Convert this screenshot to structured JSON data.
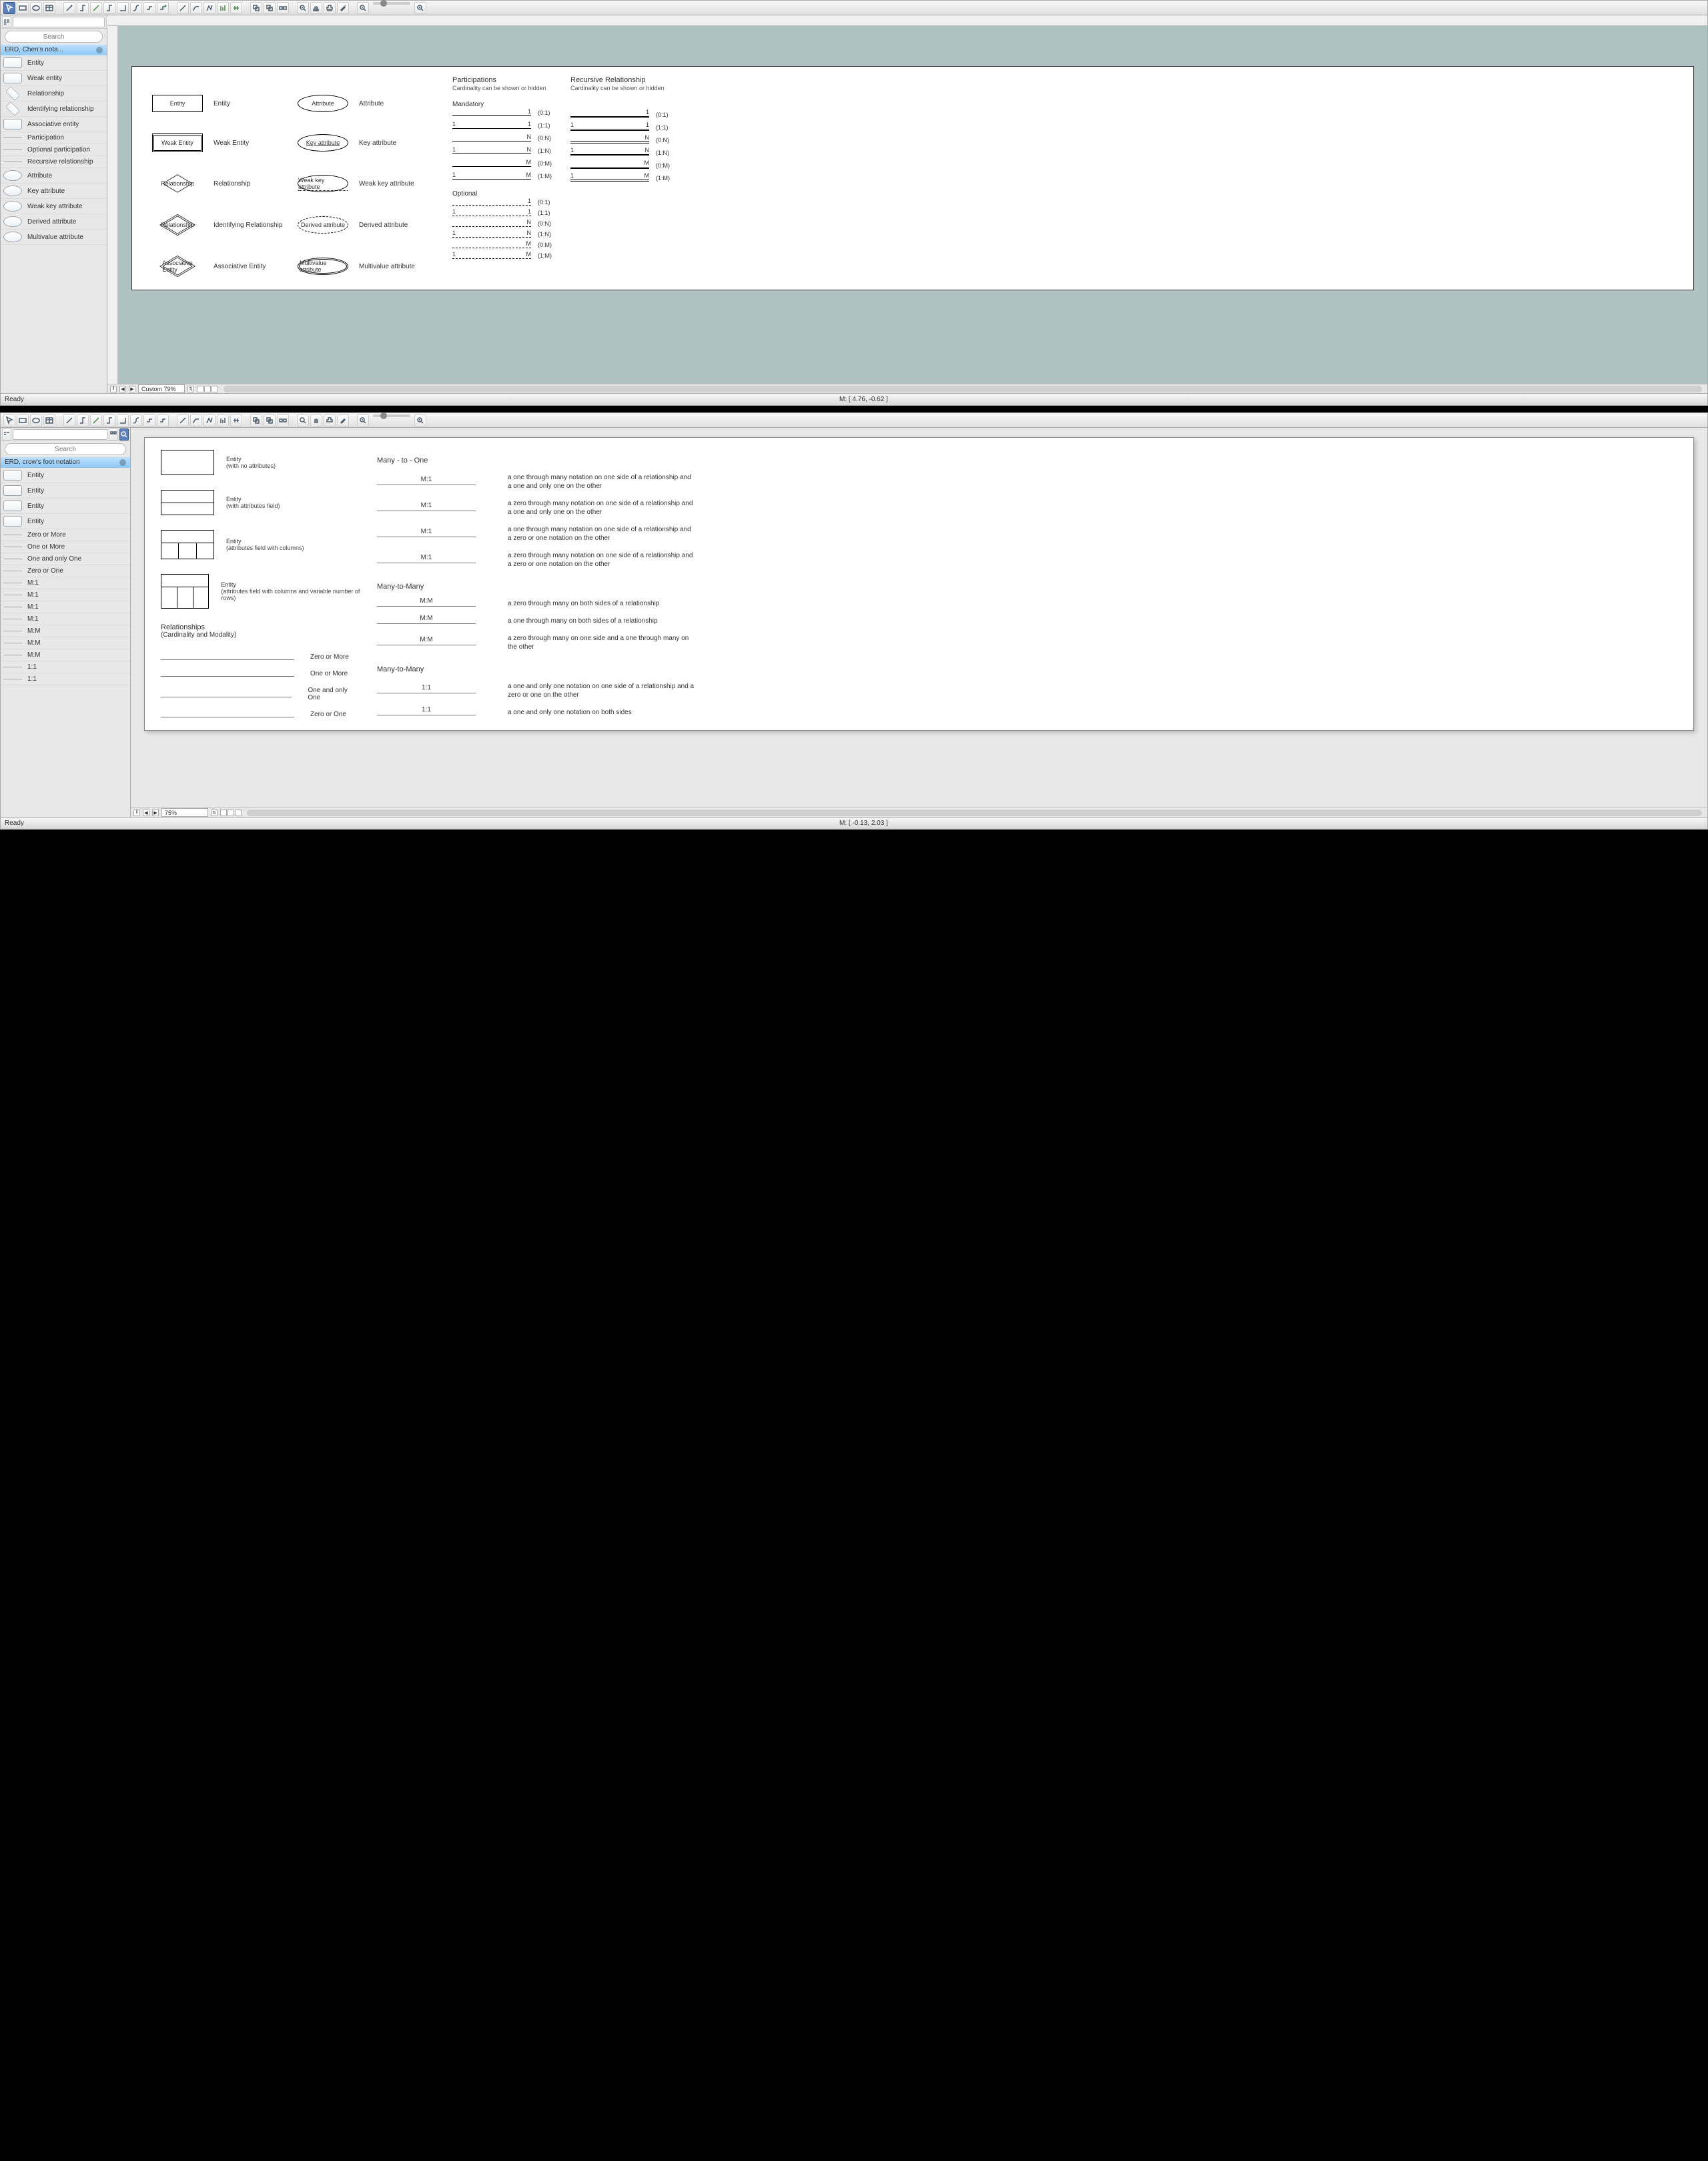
{
  "window1": {
    "search_placeholder": "Search",
    "panel_title": "ERD, Chen's nota...",
    "items": [
      {
        "label": "Entity",
        "thumb": ""
      },
      {
        "label": "Weak entity",
        "thumb": ""
      },
      {
        "label": "Relationship",
        "thumb": "diamond"
      },
      {
        "label": "Identifying relationship",
        "thumb": "diamond"
      },
      {
        "label": "Associative entity",
        "thumb": ""
      },
      {
        "label": "Participation",
        "thumb": "line"
      },
      {
        "label": "Optional participation",
        "thumb": "line"
      },
      {
        "label": "Recursive relationship",
        "thumb": "line"
      },
      {
        "label": "Attribute",
        "thumb": "oval"
      },
      {
        "label": "Key attribute",
        "thumb": "oval"
      },
      {
        "label": "Weak key attribute",
        "thumb": "oval"
      },
      {
        "label": "Derived attribute",
        "thumb": "oval"
      },
      {
        "label": "Multivalue attribute",
        "thumb": "oval"
      }
    ],
    "zoom_label": "Custom 79%",
    "coords": "M: [ 4.76, -0.62 ]",
    "status": "Ready",
    "paper": {
      "col_shapes": [
        "Entity",
        "Weak Entity",
        "Relationship",
        "Relationship",
        "Associative\nEntity"
      ],
      "col_shape_labels": [
        "Entity",
        "Weak Entity",
        "Relationship",
        "Identifying Relationship",
        "Associative Entity"
      ],
      "attr_shapes": [
        "Attribute",
        "Key attribute",
        "Weak key attribute",
        "Derived attribute",
        "Multivalue attribute"
      ],
      "attr_labels": [
        "Attribute",
        "Key attribute",
        "Weak key attribute",
        "Derived attribute",
        "Multivalue attribute"
      ],
      "part_hdr": "Participations",
      "part_sub": "Cardinality can be shown or hidden",
      "rec_hdr": "Recursive Relationship",
      "rec_sub": "Cardinality can be shown or hidden",
      "mandatory": "Mandatory",
      "optional": "Optional",
      "mand_rows": [
        {
          "l": "",
          "r": "1",
          "c": "(0:1)"
        },
        {
          "l": "1",
          "r": "1",
          "c": "(1:1)"
        },
        {
          "l": "",
          "r": "N",
          "c": "(0:N)"
        },
        {
          "l": "1",
          "r": "N",
          "c": "(1:N)"
        },
        {
          "l": "",
          "r": "M",
          "c": "(0:M)"
        },
        {
          "l": "1",
          "r": "M",
          "c": "(1:M)"
        }
      ],
      "opt_rows": [
        {
          "l": "",
          "r": "1",
          "c": "(0:1)"
        },
        {
          "l": "1",
          "r": "1",
          "c": "(1:1)"
        },
        {
          "l": "",
          "r": "N",
          "c": "(0:N)"
        },
        {
          "l": "1",
          "r": "N",
          "c": "(1:N)"
        },
        {
          "l": "",
          "r": "M",
          "c": "(0:M)"
        },
        {
          "l": "1",
          "r": "M",
          "c": "(1:M)"
        }
      ]
    }
  },
  "window2": {
    "search_placeholder": "Search",
    "panel_title": "ERD, crow's foot notation",
    "items": [
      {
        "label": "Entity",
        "thumb": ""
      },
      {
        "label": "Entity",
        "thumb": ""
      },
      {
        "label": "Entity",
        "thumb": ""
      },
      {
        "label": "Entity",
        "thumb": ""
      },
      {
        "label": "Zero or More",
        "thumb": "linearrow"
      },
      {
        "label": "One or More",
        "thumb": "linearrow"
      },
      {
        "label": "One and only One",
        "thumb": "linearrow"
      },
      {
        "label": "Zero or One",
        "thumb": "linearrow"
      },
      {
        "label": "M:1",
        "thumb": "linearrow"
      },
      {
        "label": "M:1",
        "thumb": "linearrow"
      },
      {
        "label": "M:1",
        "thumb": "linearrow"
      },
      {
        "label": "M:1",
        "thumb": "linearrow"
      },
      {
        "label": "M:M",
        "thumb": "linearrow"
      },
      {
        "label": "M:M",
        "thumb": "linearrow"
      },
      {
        "label": "M:M",
        "thumb": "linearrow"
      },
      {
        "label": "1:1",
        "thumb": "linearrow"
      },
      {
        "label": "1:1",
        "thumb": "linearrow"
      }
    ],
    "zoom_label": "75%",
    "coords": "M: [ -0.13, 2.03 ]",
    "status": "Ready",
    "paper": {
      "entities": [
        {
          "title": "Entity",
          "sub": "(with no attributes)"
        },
        {
          "title": "Entity",
          "sub": "(with attributes field)"
        },
        {
          "title": "Entity",
          "sub": "(attributes field with columns)"
        },
        {
          "title": "Entity",
          "sub": "(attributes field with columns and variable number of rows)"
        }
      ],
      "rel_hdr": "Relationships",
      "rel_sub": "(Cardinality and Modality)",
      "rel_basic": [
        "Zero or More",
        "One or More",
        "One and only One",
        "Zero or One"
      ],
      "sec_m1": "Many - to - One",
      "m1_rows": [
        {
          "lbl": "M:1",
          "desc": "a one through many notation on one side of a relationship and a one and only one on the other"
        },
        {
          "lbl": "M:1",
          "desc": "a zero through many notation on one side of a relationship and a one and only one on the other"
        },
        {
          "lbl": "M:1",
          "desc": "a one through many notation on one side of a relationship and a zero or one notation on the other"
        },
        {
          "lbl": "M:1",
          "desc": "a zero through many notation on one side of a relationship and a zero or one notation on the other"
        }
      ],
      "sec_mm": "Many-to-Many",
      "mm_rows": [
        {
          "lbl": "M:M",
          "desc": "a zero through many on both sides of a relationship"
        },
        {
          "lbl": "M:M",
          "desc": "a one through many on both sides of a relationship"
        },
        {
          "lbl": "M:M",
          "desc": "a zero through many on one side and a one through many on the other"
        }
      ],
      "sec_11": "Many-to-Many",
      "one_rows": [
        {
          "lbl": "1:1",
          "desc": "a one and only one notation on one side of a relationship and a zero or one on the other"
        },
        {
          "lbl": "1:1",
          "desc": "a one and only one notation on both sides"
        }
      ]
    }
  }
}
